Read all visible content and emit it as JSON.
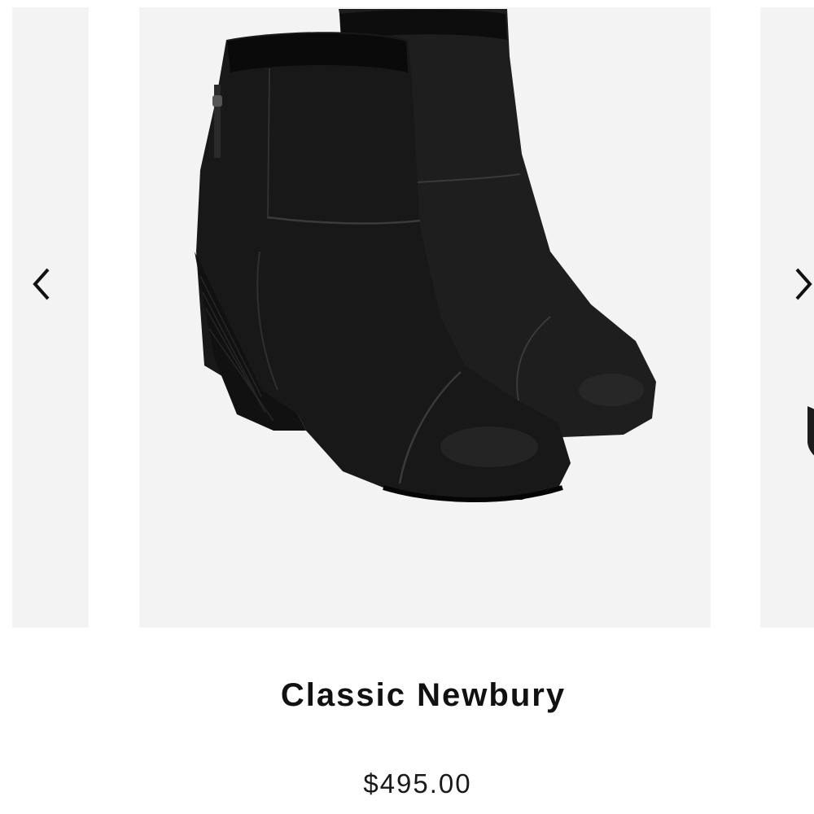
{
  "product": {
    "title": "Classic Newbury",
    "price": "$495.00"
  },
  "carousel": {
    "prev_icon": "chevron-left-icon",
    "next_icon": "chevron-right-icon",
    "main_image_icon": "ankle-boots-image",
    "slide_background": "#f4f3f4"
  },
  "colors": {
    "title": "#111111",
    "price": "#1a1a1a",
    "boot": "#1c1c1c"
  }
}
